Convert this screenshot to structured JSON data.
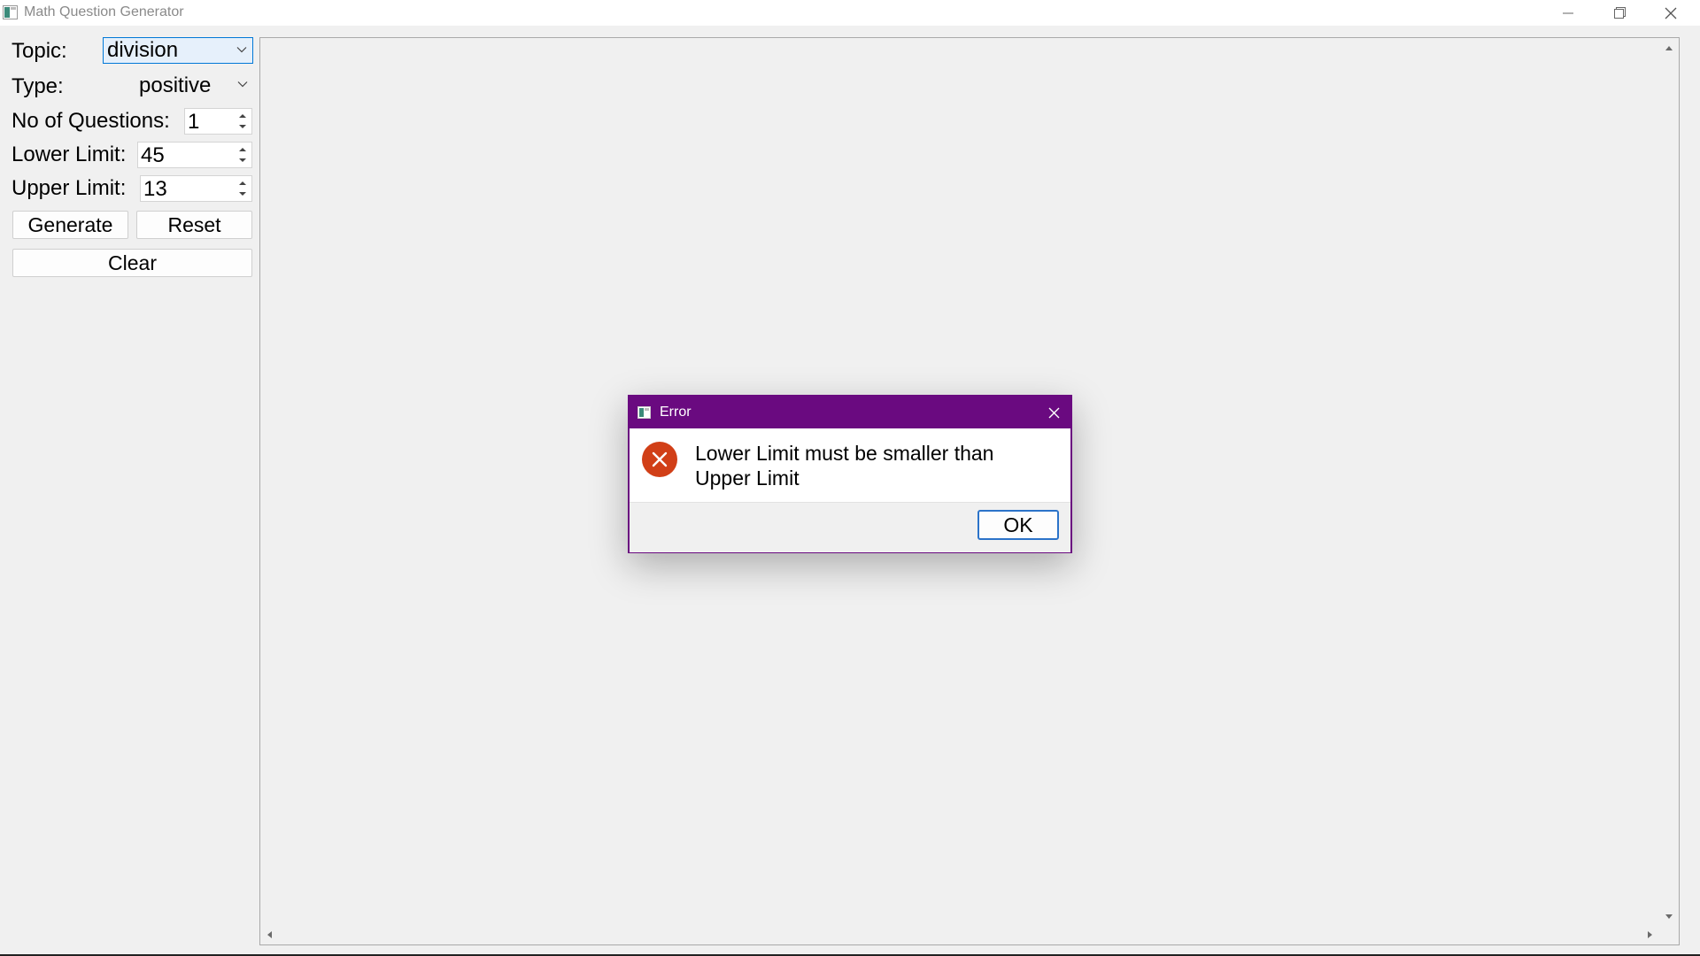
{
  "window": {
    "title": "Math Question Generator",
    "icon": "app-window-icon",
    "controls": [
      "minimize-icon",
      "restore-icon",
      "close-icon"
    ]
  },
  "form": {
    "topic": {
      "label": "Topic:",
      "value": "division"
    },
    "type": {
      "label": "Type:",
      "value": "positive"
    },
    "num_questions": {
      "label": "No of Questions:",
      "value": "1"
    },
    "lower_limit": {
      "label": "Lower Limit:",
      "value": "45"
    },
    "upper_limit": {
      "label": "Upper Limit:",
      "value": "13"
    },
    "buttons": {
      "generate": "Generate",
      "reset": "Reset",
      "clear": "Clear"
    }
  },
  "dialog": {
    "title": "Error",
    "icon": "error-icon",
    "message": "Lower Limit must be smaller than Upper Limit",
    "ok_label": "OK",
    "accent": "#6a0a80",
    "error_color": "#d13f17"
  }
}
